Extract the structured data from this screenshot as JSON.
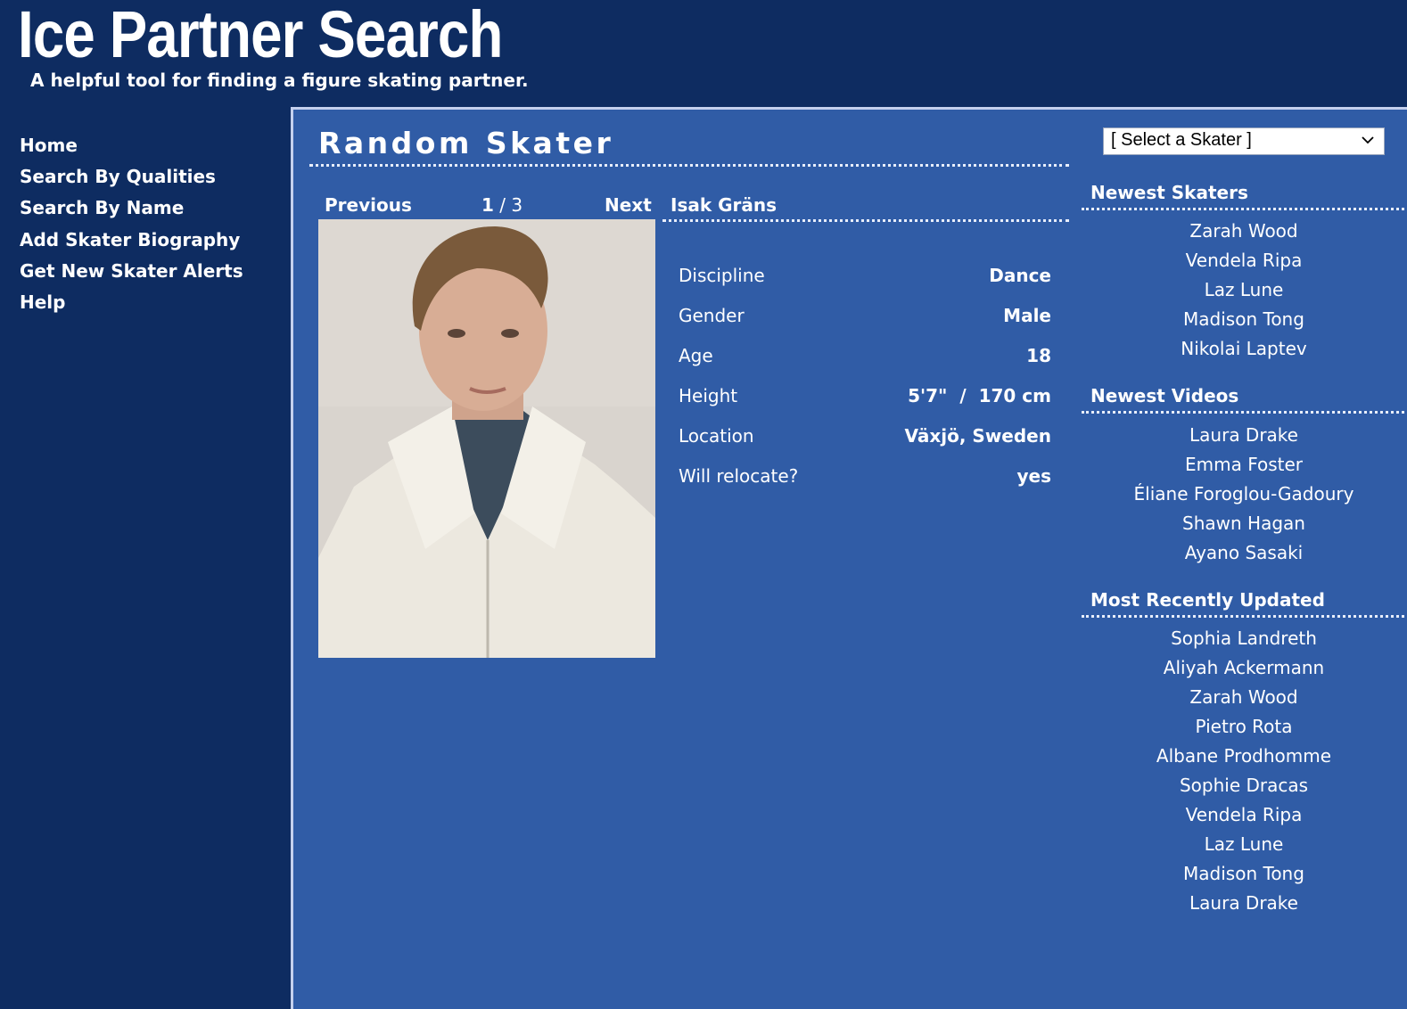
{
  "header": {
    "title": "Ice Partner Search",
    "tagline": "A helpful tool for finding a figure skating partner."
  },
  "nav": {
    "items": [
      {
        "label": "Home"
      },
      {
        "label": "Search By Qualities"
      },
      {
        "label": "Search By Name"
      },
      {
        "label": "Add Skater Biography"
      },
      {
        "label": "Get New Skater Alerts"
      },
      {
        "label": "Help"
      }
    ]
  },
  "main": {
    "heading": "Random Skater",
    "pager": {
      "previous": "Previous",
      "current": "1",
      "separator": " / ",
      "total": "3",
      "next": "Next"
    },
    "skater": {
      "name": "Isak Gräns",
      "details": [
        {
          "label": "Discipline",
          "value": "Dance"
        },
        {
          "label": "Gender",
          "value": "Male"
        },
        {
          "label": "Age",
          "value": "18"
        },
        {
          "label": "Height",
          "value": "5'7\"  /  170 cm"
        },
        {
          "label": "Location",
          "value": "Växjö, Sweden"
        },
        {
          "label": "Will relocate?",
          "value": "yes"
        }
      ]
    }
  },
  "sidebar_right": {
    "select": {
      "selected": "[ Select a Skater ]",
      "icon": "chevron-down-icon"
    },
    "newest_skaters": {
      "heading": "Newest Skaters",
      "items": [
        "Zarah Wood",
        "Vendela Ripa",
        "Laz Lune",
        "Madison Tong",
        "Nikolai Laptev"
      ]
    },
    "newest_videos": {
      "heading": "Newest Videos",
      "items": [
        "Laura Drake",
        "Emma Foster",
        "Éliane Foroglou-Gadoury",
        "Shawn Hagan",
        "Ayano Sasaki"
      ]
    },
    "recently_updated": {
      "heading": "Most Recently Updated",
      "items": [
        "Sophia Landreth",
        "Aliyah Ackermann",
        "Zarah Wood",
        "Pietro Rota",
        "Albane Prodhomme",
        "Sophie Dracas",
        "Vendela Ripa",
        "Laz Lune",
        "Madison Tong",
        "Laura Drake"
      ]
    }
  },
  "colors": {
    "page_background": "#0e2c61",
    "content_background": "#305ca6",
    "content_border": "#c4d0ee",
    "text": "#ffffff"
  }
}
